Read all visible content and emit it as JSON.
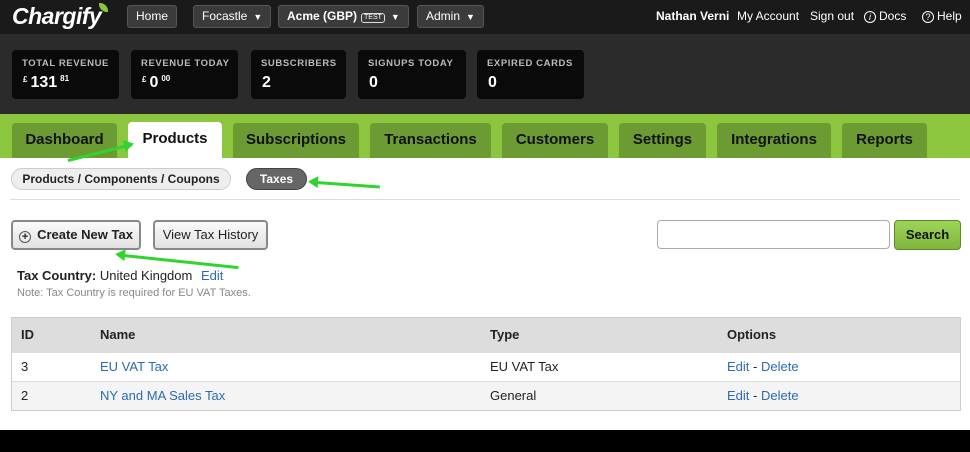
{
  "topbar": {
    "logo": "Chargify",
    "home": "Home",
    "account_switcher": "Focastle",
    "site_switcher": "Acme (GBP)",
    "site_badge": "TEST",
    "admin": "Admin",
    "user_name": "Nathan Verni",
    "my_account": "My Account",
    "sign_out": "Sign out",
    "docs": "Docs",
    "help": "Help"
  },
  "stats": [
    {
      "label": "TOTAL REVENUE",
      "currency": "£",
      "value": "131",
      "cents": "81"
    },
    {
      "label": "REVENUE TODAY",
      "currency": "£",
      "value": "0",
      "cents": "00"
    },
    {
      "label": "SUBSCRIBERS",
      "value": "2"
    },
    {
      "label": "SIGNUPS TODAY",
      "value": "0"
    },
    {
      "label": "EXPIRED CARDS",
      "value": "0"
    }
  ],
  "tabs": [
    "Dashboard",
    "Products",
    "Subscriptions",
    "Transactions",
    "Customers",
    "Settings",
    "Integrations",
    "Reports"
  ],
  "active_tab": "Products",
  "subtabs": [
    "Products / Components / Coupons",
    "Taxes"
  ],
  "active_subtab": "Taxes",
  "actions": {
    "create_tax": "Create New Tax",
    "view_history": "View Tax History",
    "search_button": "Search",
    "search_value": ""
  },
  "tax_country": {
    "label": "Tax Country:",
    "value": "United Kingdom",
    "edit": "Edit",
    "note": "Note: Tax Country is required for EU VAT Taxes."
  },
  "table": {
    "headers": [
      "ID",
      "Name",
      "Type",
      "Options"
    ],
    "rows": [
      {
        "id": "3",
        "name": "EU VAT Tax",
        "type": "EU VAT Tax",
        "edit": "Edit",
        "sep": "-",
        "delete": "Delete"
      },
      {
        "id": "2",
        "name": "NY and MA Sales Tax",
        "type": "General",
        "edit": "Edit",
        "sep": "-",
        "delete": "Delete"
      }
    ]
  },
  "colors": {
    "brand_green": "#8cc63f",
    "tab_green": "#6c9a33",
    "link": "#2a6ab8",
    "annotation_arrow": "#2fd42f"
  }
}
